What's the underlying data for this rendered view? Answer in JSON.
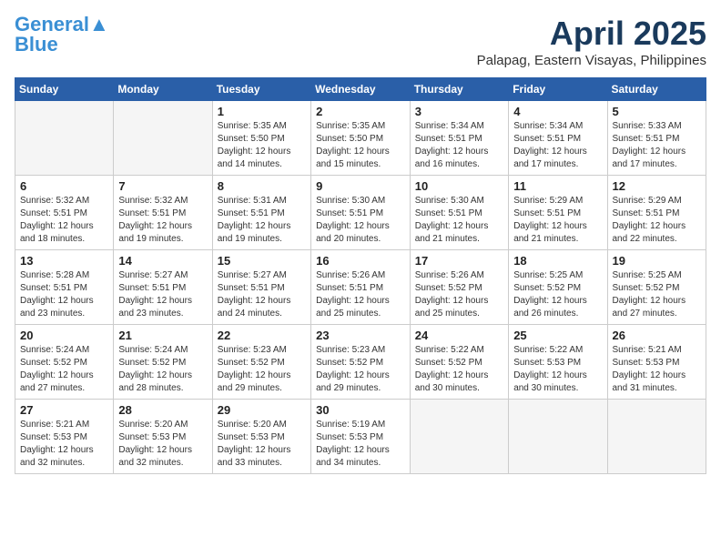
{
  "header": {
    "logo_line1": "General",
    "logo_line2": "Blue",
    "month_title": "April 2025",
    "location": "Palapag, Eastern Visayas, Philippines"
  },
  "weekdays": [
    "Sunday",
    "Monday",
    "Tuesday",
    "Wednesday",
    "Thursday",
    "Friday",
    "Saturday"
  ],
  "weeks": [
    [
      {
        "day": "",
        "sunrise": "",
        "sunset": "",
        "daylight": ""
      },
      {
        "day": "",
        "sunrise": "",
        "sunset": "",
        "daylight": ""
      },
      {
        "day": "1",
        "sunrise": "Sunrise: 5:35 AM",
        "sunset": "Sunset: 5:50 PM",
        "daylight": "Daylight: 12 hours and 14 minutes."
      },
      {
        "day": "2",
        "sunrise": "Sunrise: 5:35 AM",
        "sunset": "Sunset: 5:50 PM",
        "daylight": "Daylight: 12 hours and 15 minutes."
      },
      {
        "day": "3",
        "sunrise": "Sunrise: 5:34 AM",
        "sunset": "Sunset: 5:51 PM",
        "daylight": "Daylight: 12 hours and 16 minutes."
      },
      {
        "day": "4",
        "sunrise": "Sunrise: 5:34 AM",
        "sunset": "Sunset: 5:51 PM",
        "daylight": "Daylight: 12 hours and 17 minutes."
      },
      {
        "day": "5",
        "sunrise": "Sunrise: 5:33 AM",
        "sunset": "Sunset: 5:51 PM",
        "daylight": "Daylight: 12 hours and 17 minutes."
      }
    ],
    [
      {
        "day": "6",
        "sunrise": "Sunrise: 5:32 AM",
        "sunset": "Sunset: 5:51 PM",
        "daylight": "Daylight: 12 hours and 18 minutes."
      },
      {
        "day": "7",
        "sunrise": "Sunrise: 5:32 AM",
        "sunset": "Sunset: 5:51 PM",
        "daylight": "Daylight: 12 hours and 19 minutes."
      },
      {
        "day": "8",
        "sunrise": "Sunrise: 5:31 AM",
        "sunset": "Sunset: 5:51 PM",
        "daylight": "Daylight: 12 hours and 19 minutes."
      },
      {
        "day": "9",
        "sunrise": "Sunrise: 5:30 AM",
        "sunset": "Sunset: 5:51 PM",
        "daylight": "Daylight: 12 hours and 20 minutes."
      },
      {
        "day": "10",
        "sunrise": "Sunrise: 5:30 AM",
        "sunset": "Sunset: 5:51 PM",
        "daylight": "Daylight: 12 hours and 21 minutes."
      },
      {
        "day": "11",
        "sunrise": "Sunrise: 5:29 AM",
        "sunset": "Sunset: 5:51 PM",
        "daylight": "Daylight: 12 hours and 21 minutes."
      },
      {
        "day": "12",
        "sunrise": "Sunrise: 5:29 AM",
        "sunset": "Sunset: 5:51 PM",
        "daylight": "Daylight: 12 hours and 22 minutes."
      }
    ],
    [
      {
        "day": "13",
        "sunrise": "Sunrise: 5:28 AM",
        "sunset": "Sunset: 5:51 PM",
        "daylight": "Daylight: 12 hours and 23 minutes."
      },
      {
        "day": "14",
        "sunrise": "Sunrise: 5:27 AM",
        "sunset": "Sunset: 5:51 PM",
        "daylight": "Daylight: 12 hours and 23 minutes."
      },
      {
        "day": "15",
        "sunrise": "Sunrise: 5:27 AM",
        "sunset": "Sunset: 5:51 PM",
        "daylight": "Daylight: 12 hours and 24 minutes."
      },
      {
        "day": "16",
        "sunrise": "Sunrise: 5:26 AM",
        "sunset": "Sunset: 5:51 PM",
        "daylight": "Daylight: 12 hours and 25 minutes."
      },
      {
        "day": "17",
        "sunrise": "Sunrise: 5:26 AM",
        "sunset": "Sunset: 5:52 PM",
        "daylight": "Daylight: 12 hours and 25 minutes."
      },
      {
        "day": "18",
        "sunrise": "Sunrise: 5:25 AM",
        "sunset": "Sunset: 5:52 PM",
        "daylight": "Daylight: 12 hours and 26 minutes."
      },
      {
        "day": "19",
        "sunrise": "Sunrise: 5:25 AM",
        "sunset": "Sunset: 5:52 PM",
        "daylight": "Daylight: 12 hours and 27 minutes."
      }
    ],
    [
      {
        "day": "20",
        "sunrise": "Sunrise: 5:24 AM",
        "sunset": "Sunset: 5:52 PM",
        "daylight": "Daylight: 12 hours and 27 minutes."
      },
      {
        "day": "21",
        "sunrise": "Sunrise: 5:24 AM",
        "sunset": "Sunset: 5:52 PM",
        "daylight": "Daylight: 12 hours and 28 minutes."
      },
      {
        "day": "22",
        "sunrise": "Sunrise: 5:23 AM",
        "sunset": "Sunset: 5:52 PM",
        "daylight": "Daylight: 12 hours and 29 minutes."
      },
      {
        "day": "23",
        "sunrise": "Sunrise: 5:23 AM",
        "sunset": "Sunset: 5:52 PM",
        "daylight": "Daylight: 12 hours and 29 minutes."
      },
      {
        "day": "24",
        "sunrise": "Sunrise: 5:22 AM",
        "sunset": "Sunset: 5:52 PM",
        "daylight": "Daylight: 12 hours and 30 minutes."
      },
      {
        "day": "25",
        "sunrise": "Sunrise: 5:22 AM",
        "sunset": "Sunset: 5:53 PM",
        "daylight": "Daylight: 12 hours and 30 minutes."
      },
      {
        "day": "26",
        "sunrise": "Sunrise: 5:21 AM",
        "sunset": "Sunset: 5:53 PM",
        "daylight": "Daylight: 12 hours and 31 minutes."
      }
    ],
    [
      {
        "day": "27",
        "sunrise": "Sunrise: 5:21 AM",
        "sunset": "Sunset: 5:53 PM",
        "daylight": "Daylight: 12 hours and 32 minutes."
      },
      {
        "day": "28",
        "sunrise": "Sunrise: 5:20 AM",
        "sunset": "Sunset: 5:53 PM",
        "daylight": "Daylight: 12 hours and 32 minutes."
      },
      {
        "day": "29",
        "sunrise": "Sunrise: 5:20 AM",
        "sunset": "Sunset: 5:53 PM",
        "daylight": "Daylight: 12 hours and 33 minutes."
      },
      {
        "day": "30",
        "sunrise": "Sunrise: 5:19 AM",
        "sunset": "Sunset: 5:53 PM",
        "daylight": "Daylight: 12 hours and 34 minutes."
      },
      {
        "day": "",
        "sunrise": "",
        "sunset": "",
        "daylight": ""
      },
      {
        "day": "",
        "sunrise": "",
        "sunset": "",
        "daylight": ""
      },
      {
        "day": "",
        "sunrise": "",
        "sunset": "",
        "daylight": ""
      }
    ]
  ]
}
